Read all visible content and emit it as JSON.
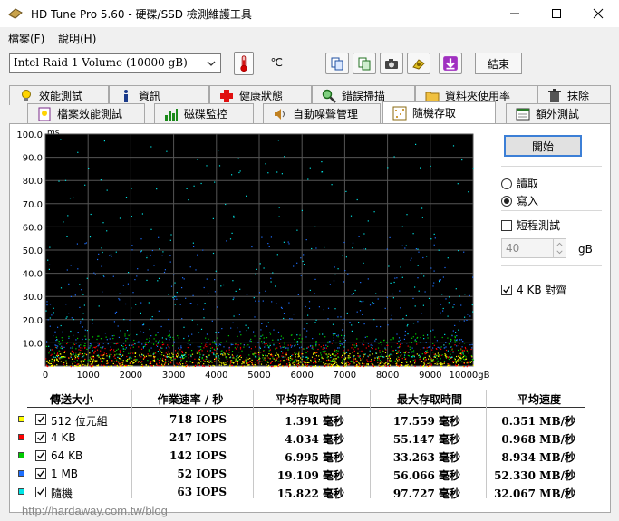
{
  "window": {
    "title": "HD Tune Pro 5.60 - 硬碟/SSD 檢測維護工具",
    "buttons": [
      "minimize",
      "maximize",
      "close"
    ]
  },
  "menu": {
    "items": [
      "檔案(F)",
      "說明(H)"
    ]
  },
  "toolbar": {
    "drive": "Intel   Raid 1 Volume (10000 gB)",
    "temperature": "-- ℃",
    "icons": [
      "copy-info-icon",
      "copy-screenshot-icon",
      "camera-icon",
      "options-icon",
      "save-icon"
    ],
    "exit_label": "結束"
  },
  "tabs": {
    "row1": [
      "效能測試",
      "資訊",
      "健康狀態",
      "錯誤掃描",
      "資料夾使用率",
      "抹除"
    ],
    "row2": [
      "檔案效能測試",
      "磁碟監控",
      "自動噪聲管理",
      "隨機存取",
      "額外測試"
    ],
    "active": "隨機存取"
  },
  "controls": {
    "start_label": "開始",
    "read_label": "讀取",
    "write_label": "寫入",
    "selected_mode": "寫入",
    "short_test_label": "短程測試",
    "short_test_checked": false,
    "short_test_value": "40",
    "short_test_unit": "gB",
    "align_label": "4 KB 對齊",
    "align_checked": true
  },
  "chart_data": {
    "type": "scatter",
    "ylabel": "ms",
    "xlabel": "gB",
    "xlim": [
      0,
      10000
    ],
    "ylim": [
      0,
      100
    ],
    "x_ticks": [
      "0",
      "1000",
      "2000",
      "3000",
      "4000",
      "5000",
      "6000",
      "7000",
      "8000",
      "9000",
      "10000gB"
    ],
    "y_ticks": [
      "100.0",
      "90.0",
      "80.0",
      "70.0",
      "60.0",
      "50.0",
      "40.0",
      "30.0",
      "20.0",
      "10.0"
    ],
    "grid": true,
    "background": "#000000",
    "series": [
      {
        "name": "512 位元組",
        "color": "#ffff00",
        "typical_ms": [
          0,
          6
        ]
      },
      {
        "name": "4 KB",
        "color": "#ff0000",
        "typical_ms": [
          0,
          10
        ]
      },
      {
        "name": "64 KB",
        "color": "#00cc00",
        "typical_ms": [
          2,
          14
        ]
      },
      {
        "name": "1 MB",
        "color": "#1e6fff",
        "typical_ms": [
          8,
          56
        ]
      },
      {
        "name": "隨機",
        "color": "#00e5e5",
        "typical_ms": [
          4,
          98
        ]
      }
    ]
  },
  "results": {
    "headers": [
      "傳送大小",
      "作業速率 / 秒",
      "平均存取時間",
      "最大存取時間",
      "平均速度"
    ],
    "rows": [
      {
        "size": "512 位元組",
        "iops": "718 IOPS",
        "avg": "1.391 毫秒",
        "max": "17.559 毫秒",
        "speed": "0.351 MB/秒",
        "color": "#ffff00"
      },
      {
        "size": "4 KB",
        "iops": "247 IOPS",
        "avg": "4.034 毫秒",
        "max": "55.147 毫秒",
        "speed": "0.968 MB/秒",
        "color": "#ff0000"
      },
      {
        "size": "64 KB",
        "iops": "142 IOPS",
        "avg": "6.995 毫秒",
        "max": "33.263 毫秒",
        "speed": "8.934 MB/秒",
        "color": "#00cc00"
      },
      {
        "size": "1 MB",
        "iops": "52 IOPS",
        "avg": "19.109 毫秒",
        "max": "56.066 毫秒",
        "speed": "52.330 MB/秒",
        "color": "#1e6fff"
      },
      {
        "size": "隨機",
        "iops": "63 IOPS",
        "avg": "15.822 毫秒",
        "max": "97.727 毫秒",
        "speed": "32.067 MB/秒",
        "color": "#00e5e5"
      }
    ]
  },
  "watermark": "http://hardaway.com.tw/blog"
}
